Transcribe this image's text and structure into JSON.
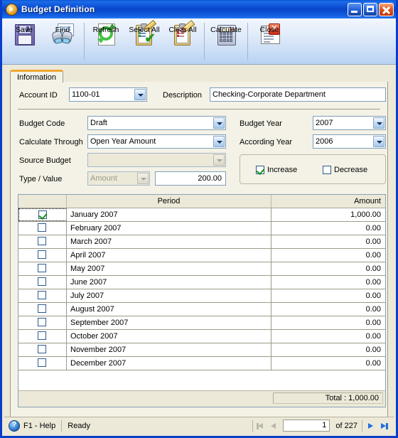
{
  "window": {
    "title": "Budget Definition",
    "icon": "app-orb-icon",
    "buttons": {
      "minimize": "minimize",
      "maximize": "maximize",
      "close": "close"
    }
  },
  "toolbar": {
    "items": [
      {
        "label": "Save",
        "icon": "floppy-disk-icon"
      },
      {
        "label": "Find",
        "icon": "binoculars-icon"
      },
      {
        "label": "Refresh",
        "icon": "refresh-arrows-icon"
      },
      {
        "label": "Select All",
        "icon": "clipboard-check-icon"
      },
      {
        "label": "Clear All",
        "icon": "clipboard-eraser-icon"
      },
      {
        "label": "Calculate",
        "icon": "calculator-icon"
      },
      {
        "label": "Close",
        "icon": "window-close-icon"
      }
    ]
  },
  "tabs": [
    {
      "label": "Information",
      "active": true
    }
  ],
  "form": {
    "account_id": {
      "label": "Account ID",
      "value": "1100-01"
    },
    "description": {
      "label": "Description",
      "value": "Checking-Corporate Department"
    },
    "budget_code": {
      "label": "Budget Code",
      "value": "Draft"
    },
    "calculate_through": {
      "label": "Calculate Through",
      "value": "Open Year Amount"
    },
    "source_budget": {
      "label": "Source Budget",
      "value": "",
      "disabled": true
    },
    "type_value": {
      "label": "Type / Value",
      "type_value": "Amount",
      "type_disabled": true,
      "amount_value": "200.00"
    },
    "budget_year": {
      "label": "Budget Year",
      "value": "2007"
    },
    "according_year": {
      "label": "According Year",
      "value": "2006"
    },
    "increase": {
      "label": "Increase",
      "checked": true
    },
    "decrease": {
      "label": "Decrease",
      "checked": false
    }
  },
  "grid": {
    "columns": [
      "",
      "Period",
      "Amount"
    ],
    "rows": [
      {
        "checked": true,
        "period": "January 2007",
        "amount": "1,000.00",
        "selected": true
      },
      {
        "checked": false,
        "period": "February 2007",
        "amount": "0.00"
      },
      {
        "checked": false,
        "period": "March 2007",
        "amount": "0.00"
      },
      {
        "checked": false,
        "period": "April 2007",
        "amount": "0.00"
      },
      {
        "checked": false,
        "period": "May 2007",
        "amount": "0.00"
      },
      {
        "checked": false,
        "period": "June 2007",
        "amount": "0.00"
      },
      {
        "checked": false,
        "period": "July 2007",
        "amount": "0.00"
      },
      {
        "checked": false,
        "period": "August 2007",
        "amount": "0.00"
      },
      {
        "checked": false,
        "period": "September 2007",
        "amount": "0.00"
      },
      {
        "checked": false,
        "period": "October 2007",
        "amount": "0.00"
      },
      {
        "checked": false,
        "period": "November 2007",
        "amount": "0.00"
      },
      {
        "checked": false,
        "period": "December 2007",
        "amount": "0.00"
      }
    ],
    "total": "Total : 1,000.00"
  },
  "statusbar": {
    "help": "F1 - Help",
    "help_icon": "question-mark-icon",
    "state": "Ready",
    "nav": {
      "first_icon": "first-record-icon",
      "prev_icon": "previous-record-icon",
      "next_icon": "next-record-icon",
      "last_icon": "last-record-icon",
      "page": "1",
      "of": "of  227"
    }
  },
  "colors": {
    "titlebar": "#0a46c8",
    "tab_accent": "#f0a732",
    "face": "#ece9d8",
    "panel": "#f4f2e6",
    "field_border": "#7f9db9"
  }
}
